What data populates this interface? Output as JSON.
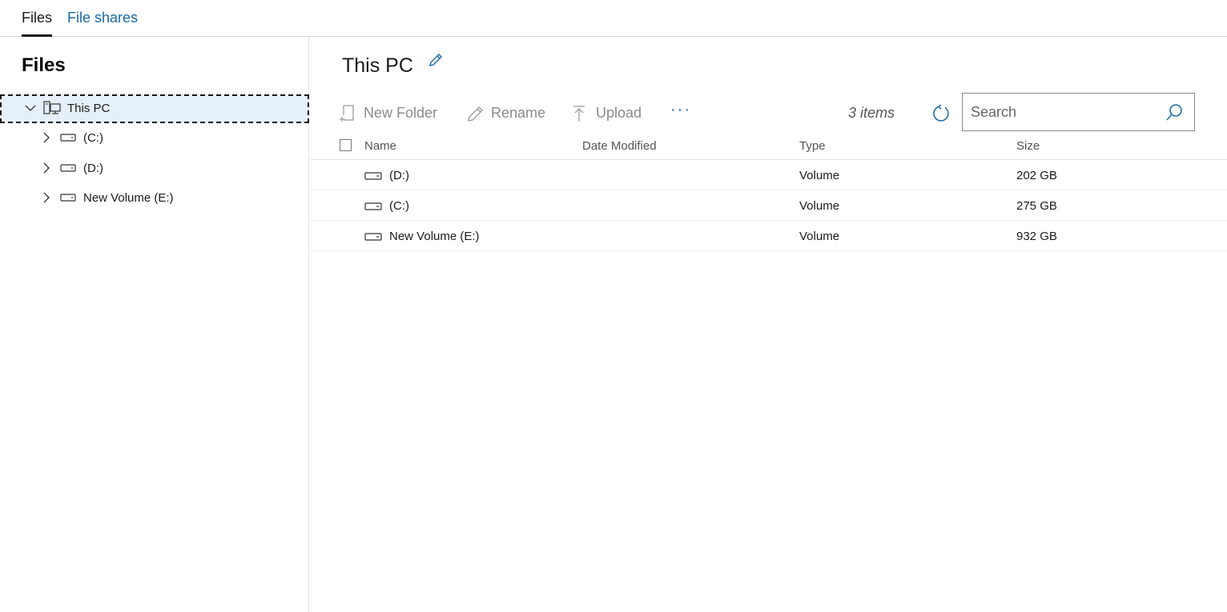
{
  "tabs": [
    {
      "label": "Files"
    },
    {
      "label": "File shares"
    }
  ],
  "left_panel": {
    "title": "Files",
    "tree": [
      {
        "label": "This PC",
        "icon": "computer-icon",
        "expanded": true,
        "selected": true
      },
      {
        "label": "(C:)",
        "icon": "drive-icon"
      },
      {
        "label": "(D:)",
        "icon": "drive-icon"
      },
      {
        "label": "New Volume (E:)",
        "icon": "drive-icon"
      }
    ]
  },
  "main": {
    "title": "This PC",
    "toolbar": {
      "new_folder": "New Folder",
      "rename": "Rename",
      "upload": "Upload",
      "more": "···"
    },
    "item_count": "3 items",
    "search": {
      "placeholder": "Search",
      "value": ""
    },
    "columns": {
      "name": "Name",
      "date_modified": "Date Modified",
      "type": "Type",
      "size": "Size"
    },
    "rows": [
      {
        "name": "(D:)",
        "date_modified": "",
        "type": "Volume",
        "size": "202 GB"
      },
      {
        "name": "(C:)",
        "date_modified": "",
        "type": "Volume",
        "size": "275 GB"
      },
      {
        "name": "New Volume (E:)",
        "date_modified": "",
        "type": "Volume",
        "size": "932 GB"
      }
    ]
  },
  "colors": {
    "accent": "#1a6aa7",
    "selected_bg": "#e6f0fa",
    "disabled_text": "#8a8a8a"
  }
}
